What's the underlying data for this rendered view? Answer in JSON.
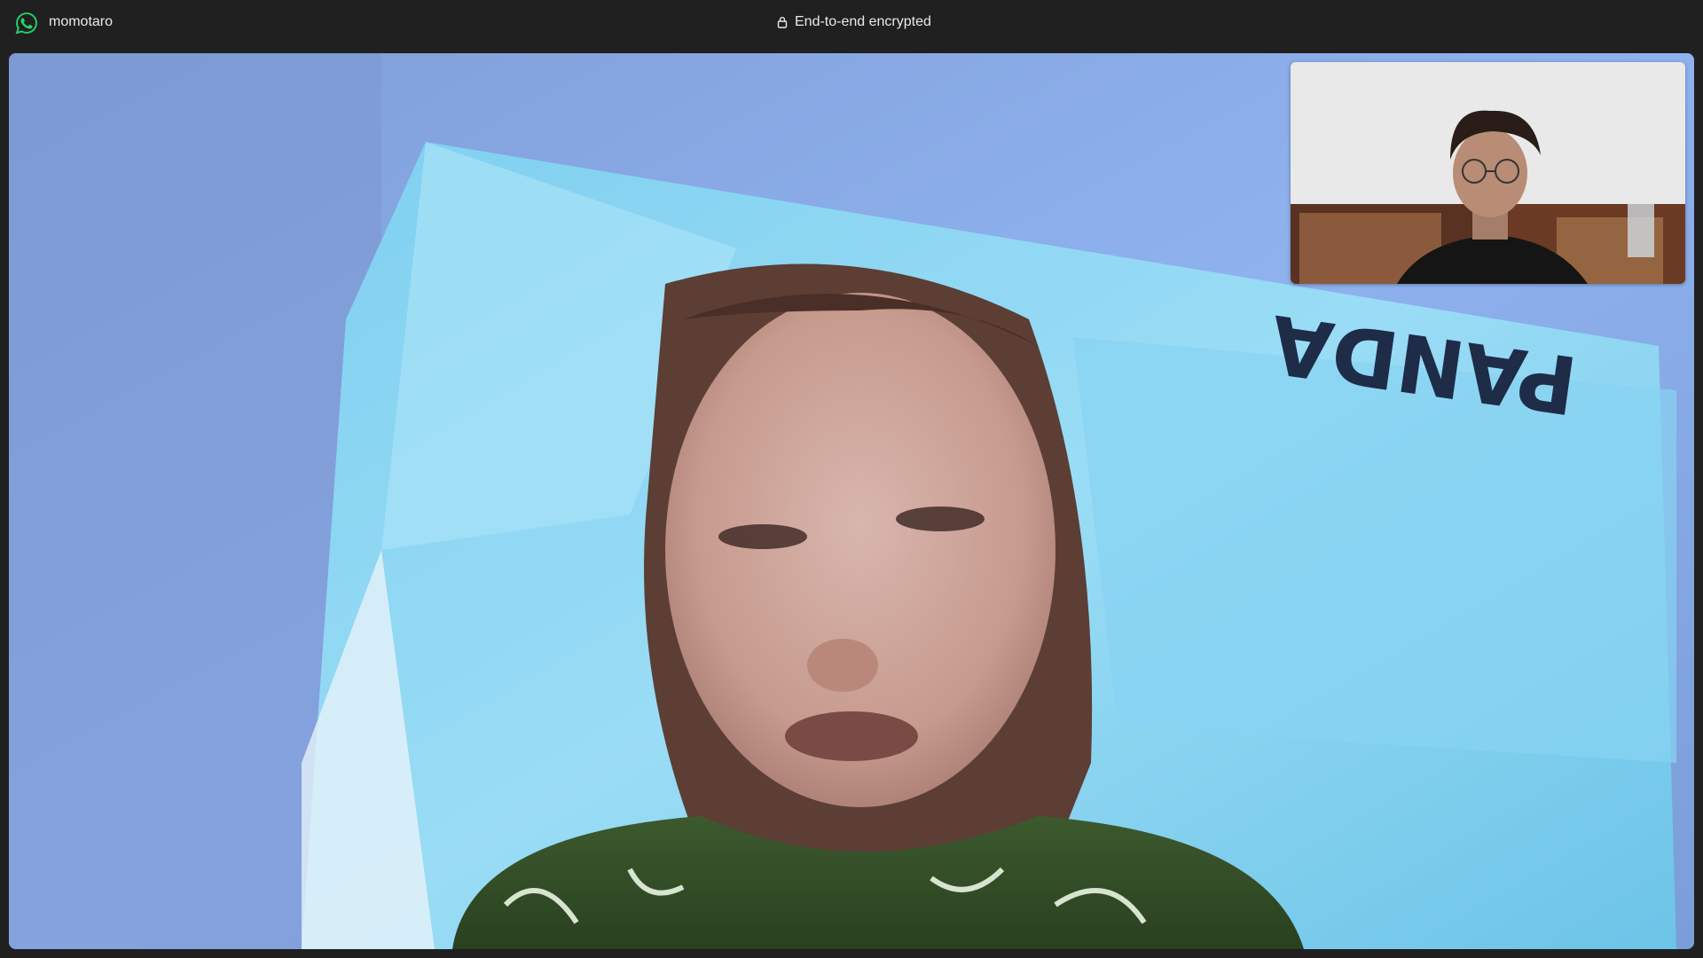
{
  "titlebar": {
    "app_icon": "whatsapp-icon",
    "contact_name": "momotaro",
    "encryption_icon": "lock-icon",
    "encryption_text": "End-to-end encrypted"
  },
  "remote_video": {
    "description_icon": "remote-participant-video"
  },
  "self_view": {
    "description_icon": "self-camera-preview"
  },
  "colors": {
    "titlebar_bg": "#202020",
    "text": "#e9e9e9",
    "whatsapp_green": "#25d366"
  }
}
